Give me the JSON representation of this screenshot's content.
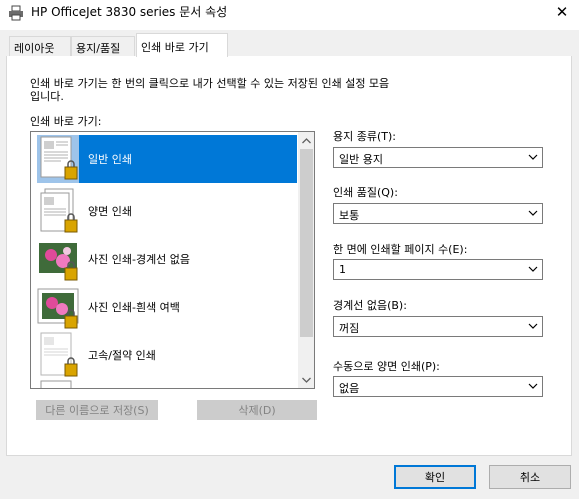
{
  "window": {
    "title": "HP OfficeJet 3830 series 문서 속성",
    "close_glyph": "✕"
  },
  "tabs": [
    {
      "label": "레이아웃"
    },
    {
      "label": "용지/품질"
    },
    {
      "label": "인쇄 바로 가기"
    }
  ],
  "description": "인쇄 바로 가기는 한 번의 클릭으로 내가 선택할 수 있는 저장된 인쇄 설정 모음입니다.",
  "shortcuts": {
    "label": "인쇄 바로 가기:",
    "items": [
      {
        "label": "일반 인쇄",
        "selected": true
      },
      {
        "label": "양면 인쇄"
      },
      {
        "label": "사진 인쇄-경계선 없음"
      },
      {
        "label": "사진 인쇄-흰색 여백"
      },
      {
        "label": "고속/절약 인쇄"
      }
    ],
    "save_as_label": "다른 이름으로 저장(S)",
    "delete_label": "삭제(D)"
  },
  "settings": {
    "paper_type": {
      "label": "용지 종류(T):",
      "value": "일반 용지"
    },
    "print_quality": {
      "label": "인쇄 품질(Q):",
      "value": "보통"
    },
    "pages_per_sheet": {
      "label": "한 면에 인쇄할 페이지 수(E):",
      "value": "1"
    },
    "borderless": {
      "label": "경계선 없음(B):",
      "value": "꺼짐"
    },
    "manual_duplex": {
      "label": "수동으로 양면 인쇄(P):",
      "value": "없음"
    }
  },
  "footer": {
    "ok_label": "확인",
    "cancel_label": "취소"
  },
  "colors": {
    "accent": "#0078d7",
    "disabled_bg": "#cccccc",
    "disabled_text": "#838383"
  }
}
